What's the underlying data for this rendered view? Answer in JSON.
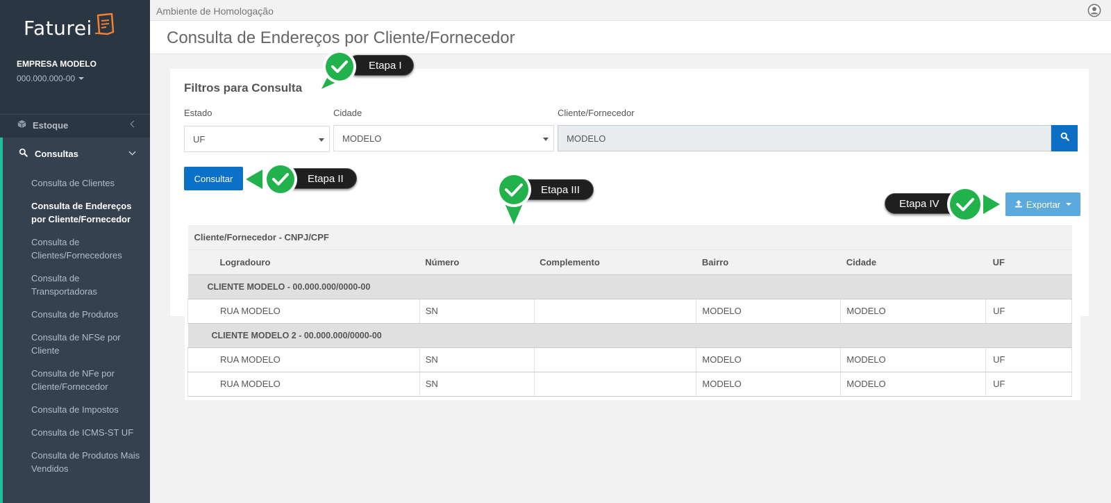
{
  "colors": {
    "sidebar": "#2b3643",
    "accent": "#1fbf97",
    "primary": "#0b70c7",
    "export": "#5ba9dd",
    "logo_orange": "#f2802e",
    "step_green": "#22b24c"
  },
  "app": {
    "logo_text": "Faturei",
    "environment": "Ambiente de Homologação"
  },
  "company": {
    "name": "EMPRESA MODELO",
    "cnpj": "000.000.000-00"
  },
  "sidebar": {
    "estoque": {
      "label": "Estoque",
      "icon": "cube-icon"
    },
    "consultas": {
      "label": "Consultas",
      "icon": "search-icon",
      "items": [
        {
          "label": "Consulta de Clientes"
        },
        {
          "label": "Consulta de Endereços por Cliente/Fornecedor",
          "active": true
        },
        {
          "label": "Consulta de Clientes/Fornecedores"
        },
        {
          "label": "Consulta de Transportadoras"
        },
        {
          "label": "Consulta de Produtos"
        },
        {
          "label": "Consulta de NFSe por Cliente"
        },
        {
          "label": "Consulta de NFe por Cliente/Fornecedor"
        },
        {
          "label": "Consulta de Impostos"
        },
        {
          "label": "Consulta de ICMS-ST UF"
        },
        {
          "label": "Consulta de Produtos Mais Vendidos"
        }
      ]
    }
  },
  "page": {
    "title": "Consulta de Endereços por Cliente/Fornecedor"
  },
  "filters": {
    "title": "Filtros para Consulta",
    "estado": {
      "label": "Estado",
      "value": "UF"
    },
    "cidade": {
      "label": "Cidade",
      "value": "MODELO"
    },
    "cliente": {
      "label": "Cliente/Fornecedor",
      "value": "MODELO"
    },
    "consultar_label": "Consultar",
    "exportar_label": "Exportar"
  },
  "steps": [
    "Etapa I",
    "Etapa II",
    "Etapa III",
    "Etapa IV"
  ],
  "table": {
    "caption": "Cliente/Fornecedor - CNPJ/CPF",
    "columns": [
      "Logradouro",
      "Número",
      "Complemento",
      "Bairro",
      "Cidade",
      "UF"
    ],
    "groups": [
      {
        "title": "CLIENTE MODELO - 00.000.000/0000-00",
        "rows": [
          [
            "RUA MODELO",
            "SN",
            "",
            "MODELO",
            "MODELO",
            "UF"
          ]
        ]
      },
      {
        "title": "CLIENTE MODELO 2 - 00.000.000/0000-00",
        "rows": [
          [
            "RUA MODELO",
            "SN",
            "",
            "MODELO",
            "MODELO",
            "UF"
          ],
          [
            "RUA MODELO",
            "SN",
            "",
            "MODELO",
            "MODELO",
            "UF"
          ]
        ]
      }
    ]
  }
}
